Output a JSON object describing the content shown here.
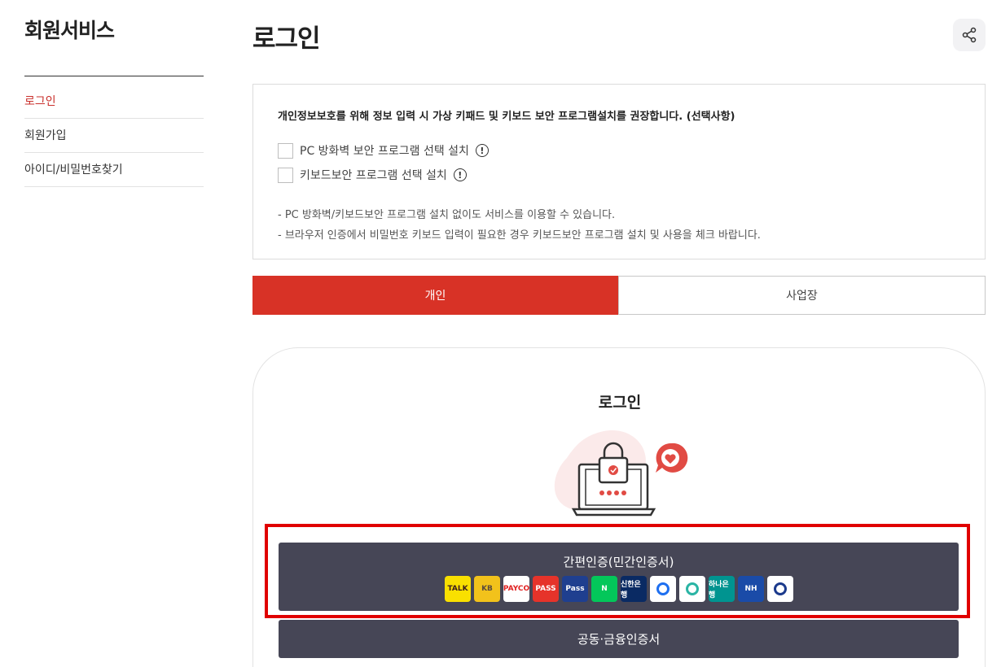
{
  "sidebar": {
    "title": "회원서비스",
    "items": [
      {
        "label": "로그인"
      },
      {
        "label": "회원가입"
      },
      {
        "label": "아이디/비밀번호찾기"
      }
    ]
  },
  "page": {
    "title": "로그인",
    "share_icon": "share-icon"
  },
  "security": {
    "heading": "개인정보보호를 위해 정보 입력 시 가상 키패드 및 키보드 보안 프로그램설치를 권장합니다. (선택사항)",
    "options": [
      {
        "label": "PC 방화벽 보안 프로그램 선택 설치"
      },
      {
        "label": "키보드보안 프로그램 선택 설치"
      }
    ],
    "info_glyph": "!",
    "notes": [
      "- PC 방화벽/키보드보안 프로그램 설치 없이도 서비스를 이용할 수 있습니다.",
      "- 브라우저 인증에서 비밀번호 키보드 입력이 필요한 경우 키보드보안 프로그램 설치 및 사용을 체크 바랍니다."
    ]
  },
  "tabs": [
    {
      "label": "개인"
    },
    {
      "label": "사업장"
    }
  ],
  "login": {
    "title": "로그인",
    "easy_auth_label": "간편인증(민간인증서)",
    "cert_label": "공동·금융인증서",
    "providers": [
      {
        "name": "kakao",
        "text": "TALK",
        "bg": "#f9e000",
        "fg": "#3a1d1d"
      },
      {
        "name": "kb",
        "text": "KB",
        "bg": "#f2c21b",
        "fg": "#5b4b3b"
      },
      {
        "name": "payco",
        "text": "PAYCO",
        "bg": "#ffffff",
        "fg": "#e02020"
      },
      {
        "name": "pass",
        "text": "PASS",
        "bg": "#e6332a",
        "fg": "#ffffff"
      },
      {
        "name": "samsung-pass",
        "text": "Pass",
        "bg": "#1f3f8f",
        "fg": "#ffffff"
      },
      {
        "name": "naver",
        "text": "N",
        "bg": "#03c75a",
        "fg": "#ffffff"
      },
      {
        "name": "shinhan",
        "text": "신한은행",
        "bg": "#0a2a63",
        "fg": "#ffffff"
      },
      {
        "name": "toss",
        "text": "",
        "bg": "#ffffff",
        "fg": "#1e6ff0"
      },
      {
        "name": "banksalad",
        "text": "",
        "bg": "#ffffff",
        "fg": "#2ab4a4"
      },
      {
        "name": "hana",
        "text": "하나은행",
        "bg": "#009490",
        "fg": "#ffffff"
      },
      {
        "name": "nh",
        "text": "NH",
        "bg": "#1a4ba8",
        "fg": "#ffffff"
      },
      {
        "name": "woori",
        "text": "",
        "bg": "#ffffff",
        "fg": "#1b3a8c"
      }
    ]
  },
  "colors": {
    "accent": "#d83226",
    "button": "#464656",
    "highlight": "#e00000"
  }
}
